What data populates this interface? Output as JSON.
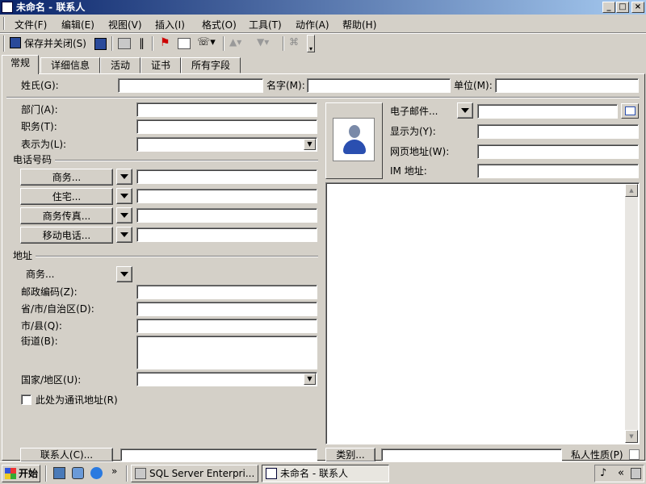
{
  "window": {
    "title": "未命名 - 联系人"
  },
  "menu": [
    "文件(F)",
    "编辑(E)",
    "视图(V)",
    "插入(I)",
    "格式(O)",
    "工具(T)",
    "动作(A)",
    "帮助(H)"
  ],
  "toolbar": {
    "save_close": "保存并关闭(S)"
  },
  "tabs": [
    "常规",
    "详细信息",
    "活动",
    "证书",
    "所有字段"
  ],
  "name_row": {
    "surname": "姓氏(G):",
    "given": "名字(M):",
    "company": "单位(M):"
  },
  "left": {
    "dept": "部门(A):",
    "title": "职务(T):",
    "display_as": "表示为(L):",
    "phone_section": "电话号码",
    "phone_buttons": [
      "商务...",
      "住宅...",
      "商务传真...",
      "移动电话..."
    ],
    "address_section": "地址",
    "address_type": "商务...",
    "postal": "邮政编码(Z):",
    "province": "省/市/自治区(D):",
    "city": "市/县(Q):",
    "street": "街道(B):",
    "country": "国家/地区(U):",
    "mailing": "此处为通讯地址(R)"
  },
  "right": {
    "email": "电子邮件...",
    "display": "显示为(Y):",
    "web": "网页地址(W):",
    "im": "IM 地址:"
  },
  "bottom": {
    "contacts": "联系人(C)...",
    "categories": "类别...",
    "private": "私人性质(P)"
  },
  "taskbar": {
    "start": "开始",
    "tasks": [
      "SQL Server Enterpri...",
      "未命名 - 联系人"
    ]
  }
}
